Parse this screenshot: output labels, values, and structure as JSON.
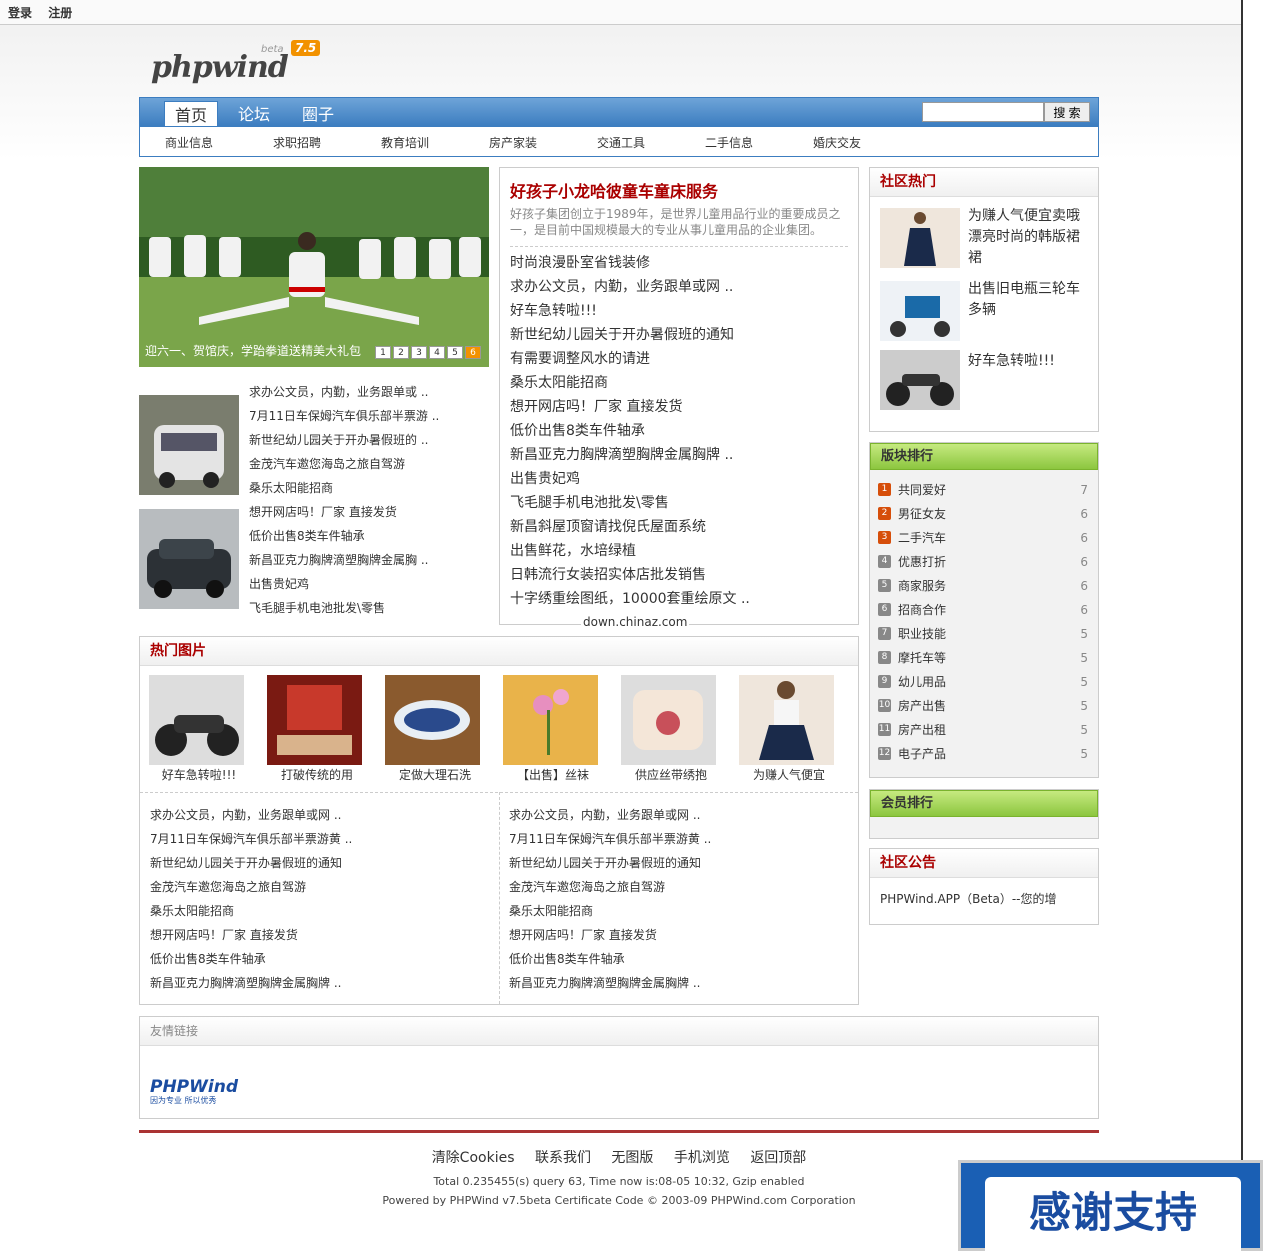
{
  "topbar": {
    "login": "登录",
    "register": "注册"
  },
  "logo": {
    "text": "phpwind",
    "beta": "beta",
    "ver": "7.5"
  },
  "nav": {
    "tabs": [
      "首页",
      "论坛",
      "圈子"
    ],
    "search_btn": "搜 索"
  },
  "subnav": [
    "商业信息",
    "求职招聘",
    "教育培训",
    "房产家装",
    "交通工具",
    "二手信息",
    "婚庆交友"
  ],
  "slide": {
    "caption": "迎六一、贺馆庆，学跆拳道送精美大礼包",
    "nums": [
      "1",
      "2",
      "3",
      "4",
      "5",
      "6"
    ]
  },
  "leftlist": [
    "求办公文员，内勤，业务跟单或 ..",
    "7月11日车保姆汽车俱乐部半票游 ..",
    "新世纪幼儿园关于开办暑假班的 ..",
    "金茂汽车邀您海岛之旅自驾游",
    "桑乐太阳能招商",
    "想开网店吗！厂家 直接发货",
    "低价出售8类车件轴承",
    "新昌亚克力胸牌滴塑胸牌金属胸 ..",
    "出售贵妃鸡",
    "飞毛腿手机电池批发\\零售"
  ],
  "headline": {
    "title": "好孩子小龙哈彼童车童床服务",
    "desc": "好孩子集团创立于1989年，是世界儿童用品行业的重要成员之一，是目前中国规模最大的专业从事儿童用品的企业集团。"
  },
  "centerlist": [
    "时尚浪漫卧室省钱装修",
    "求办公文员，内勤，业务跟单或网 ..",
    "好车急转啦!!!",
    "新世纪幼儿园关于开办暑假班的通知",
    "有需要调整风水的请进",
    "桑乐太阳能招商",
    "想开网店吗！厂家 直接发货",
    "低价出售8类车件轴承",
    "新昌亚克力胸牌滴塑胸牌金属胸牌 ..",
    "出售贵妃鸡",
    "飞毛腿手机电池批发\\零售",
    "新昌斜屋顶窗请找倪氏屋面系统",
    "出售鲜花，水培绿植",
    "日韩流行女装招实体店批发销售",
    "十字绣重绘图纸，10000套重绘原文 .."
  ],
  "watermark": "down.chinaz.com",
  "hotpics": {
    "title": "热门图片",
    "items": [
      "好车急转啦!!!",
      "打破传统的用",
      "定做大理石洗",
      "【出售】丝袜",
      "供应丝带绣抱",
      "为赚人气便宜"
    ]
  },
  "bottomlist": [
    "求办公文员，内勤，业务跟单或网 ..",
    "7月11日车保姆汽车俱乐部半票游黄 ..",
    "新世纪幼儿园关于开办暑假班的通知",
    "金茂汽车邀您海岛之旅自驾游",
    "桑乐太阳能招商",
    "想开网店吗！厂家 直接发货",
    "低价出售8类车件轴承",
    "新昌亚克力胸牌滴塑胸牌金属胸牌 .."
  ],
  "hot": {
    "title": "社区热门",
    "items": [
      "为赚人气便宜卖哦　漂亮时尚的韩版裙裙",
      "出售旧电瓶三轮车多辆",
      "好车急转啦!!!"
    ]
  },
  "rank": {
    "title": "版块排行",
    "items": [
      {
        "n": "1",
        "name": "共同爱好",
        "c": "7"
      },
      {
        "n": "2",
        "name": "男征女友",
        "c": "6"
      },
      {
        "n": "3",
        "name": "二手汽车",
        "c": "6"
      },
      {
        "n": "4",
        "name": "优惠打折",
        "c": "6"
      },
      {
        "n": "5",
        "name": "商家服务",
        "c": "6"
      },
      {
        "n": "6",
        "name": "招商合作",
        "c": "6"
      },
      {
        "n": "7",
        "name": "职业技能",
        "c": "5"
      },
      {
        "n": "8",
        "name": "摩托车等",
        "c": "5"
      },
      {
        "n": "9",
        "name": "幼儿用品",
        "c": "5"
      },
      {
        "n": "10",
        "name": "房产出售",
        "c": "5"
      },
      {
        "n": "11",
        "name": "房产出租",
        "c": "5"
      },
      {
        "n": "12",
        "name": "电子产品",
        "c": "5"
      }
    ]
  },
  "members": {
    "title": "会员排行"
  },
  "notice": {
    "title": "社区公告",
    "text": "PHPWind.APP（Beta）--您的增"
  },
  "friendlinks": {
    "title": "友情链接",
    "logo": "PHPWind",
    "slogan": "因为专业 所以优秀"
  },
  "footer": {
    "links": [
      "清除Cookies",
      "联系我们",
      "无图版",
      "手机浏览",
      "返回顶部"
    ],
    "info": "Total 0.235455(s) query 63, Time now is:08-05 10:32, Gzip enabled",
    "powered": "Powered by PHPWind v7.5beta Certificate Code © 2003-09 PHPWind.com Corporation"
  },
  "thanks": "感谢支持"
}
